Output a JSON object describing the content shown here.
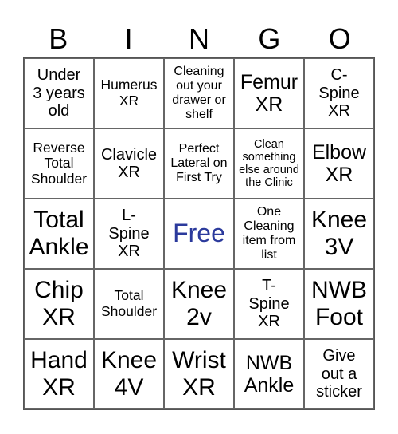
{
  "header": [
    "B",
    "I",
    "N",
    "G",
    "O"
  ],
  "free_color": "#2b3a9c",
  "cells": [
    {
      "text": "Under\n3 years\nold",
      "size": "s20"
    },
    {
      "text": "Humerus\nXR",
      "size": "s17"
    },
    {
      "text": "Cleaning\nout your\ndrawer or\nshelf",
      "size": "s15"
    },
    {
      "text": "Femur\nXR",
      "size": "s25"
    },
    {
      "text": "C-\nSpine\nXR",
      "size": "s20"
    },
    {
      "text": "Reverse\nTotal\nShoulder",
      "size": "s17"
    },
    {
      "text": "Clavicle\nXR",
      "size": "s20"
    },
    {
      "text": "Perfect\nLateral on\nFirst Try",
      "size": "s15"
    },
    {
      "text": "Clean\nsomething\nelse around\nthe Clinic",
      "size": "s14"
    },
    {
      "text": "Elbow\nXR",
      "size": "s25"
    },
    {
      "text": "Total\nAnkle",
      "size": "s30"
    },
    {
      "text": "L-\nSpine\nXR",
      "size": "s20"
    },
    {
      "text": "Free",
      "size": "free",
      "free": true
    },
    {
      "text": "One\nCleaning\nitem from\nlist",
      "size": "s15"
    },
    {
      "text": "Knee\n3V",
      "size": "s30"
    },
    {
      "text": "Chip\nXR",
      "size": "s30"
    },
    {
      "text": "Total\nShoulder",
      "size": "s17"
    },
    {
      "text": "Knee\n2v",
      "size": "s30"
    },
    {
      "text": "T-\nSpine\nXR",
      "size": "s20"
    },
    {
      "text": "NWB\nFoot",
      "size": "s30"
    },
    {
      "text": "Hand\nXR",
      "size": "s30"
    },
    {
      "text": "Knee\n4V",
      "size": "s30"
    },
    {
      "text": "Wrist\nXR",
      "size": "s30"
    },
    {
      "text": "NWB\nAnkle",
      "size": "s25"
    },
    {
      "text": "Give\nout a\nsticker",
      "size": "s20"
    }
  ]
}
